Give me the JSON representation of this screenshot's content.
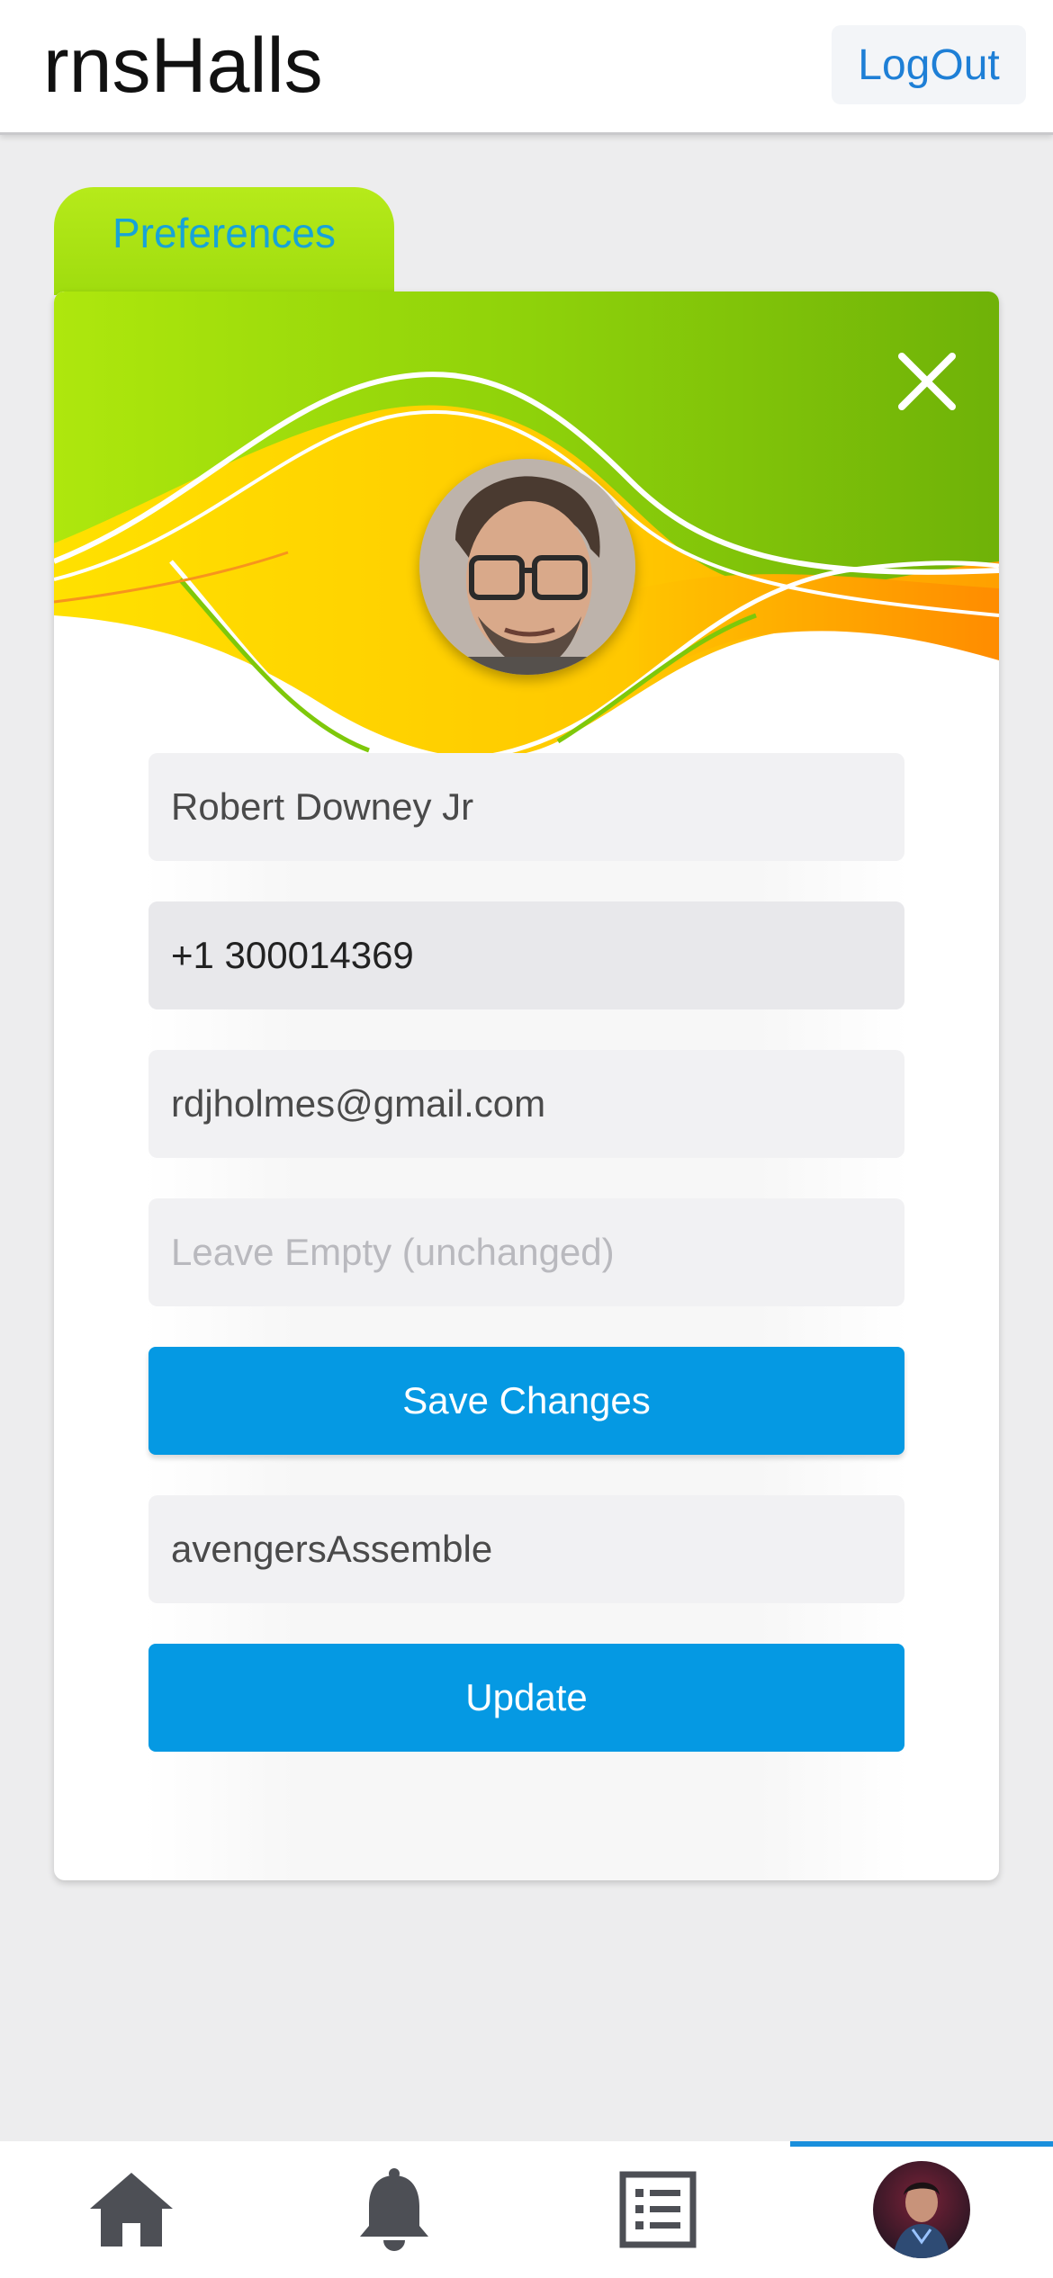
{
  "header": {
    "app_title": "rnsHalls",
    "logout_label": "LogOut"
  },
  "tab": {
    "label": "Preferences"
  },
  "profile_form": {
    "name_value": "Robert Downey Jr",
    "phone_value": "+1 300014369",
    "email_value": "rdjholmes@gmail.com",
    "password_placeholder": "Leave Empty (unchanged)",
    "save_label": "Save Changes",
    "secret_value": "avengersAssemble",
    "update_label": "Update"
  },
  "icons": {
    "close": "close-icon",
    "home": "home-icon",
    "notifications": "bell-icon",
    "list": "list-icon",
    "profile": "profile-avatar"
  },
  "bottom_nav": {
    "active_index": 3
  },
  "colors": {
    "accent": "#0599e3",
    "link": "#1e7fd6",
    "tab_green": "#a6e213",
    "banner_yellow": "#ffd400",
    "banner_orange": "#ff9800"
  }
}
